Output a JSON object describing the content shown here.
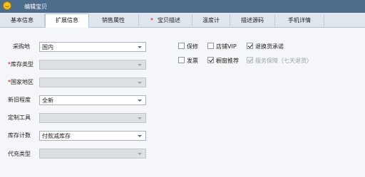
{
  "window": {
    "title": "编辑宝贝"
  },
  "tabs": [
    {
      "label": "基本信息",
      "required": false,
      "active": false
    },
    {
      "label": "扩展信息",
      "required": false,
      "active": true
    },
    {
      "label": "销售属性",
      "required": false,
      "active": false
    },
    {
      "label": "宝贝描述",
      "required": true,
      "active": false
    },
    {
      "label": "温度计",
      "required": false,
      "active": false
    },
    {
      "label": "描述源码",
      "required": false,
      "active": false
    },
    {
      "label": "手机详情",
      "required": false,
      "active": false
    }
  ],
  "form": {
    "origin": {
      "label": "采购地",
      "value": "国内",
      "required": false,
      "disabled": false
    },
    "stock_type": {
      "label": "库存类型",
      "value": "",
      "required": true,
      "disabled": true
    },
    "country": {
      "label": "国家地区",
      "value": "",
      "required": true,
      "disabled": true
    },
    "condition": {
      "label": "新旧程度",
      "value": "全新",
      "required": false,
      "disabled": false
    },
    "custom_tool": {
      "label": "定制工具",
      "value": "",
      "required": false,
      "disabled": true
    },
    "stock_count": {
      "label": "库存计数",
      "value": "付款减库存",
      "required": false,
      "disabled": false
    },
    "agent_type": {
      "label": "代充类型",
      "value": "",
      "required": false,
      "disabled": true
    }
  },
  "star_symbol": "*",
  "options": {
    "warranty": {
      "label": "保修",
      "checked": false,
      "disabled": false
    },
    "shop_vip": {
      "label": "店铺VIP",
      "checked": false,
      "disabled": false
    },
    "return_promise": {
      "label": "退换货承诺",
      "checked": true,
      "disabled": false
    },
    "invoice": {
      "label": "发票",
      "checked": false,
      "disabled": false
    },
    "showcase": {
      "label": "橱窗推荐",
      "checked": true,
      "disabled": false
    },
    "service_guarantee": {
      "label": "服务保障（七天退货）",
      "checked": true,
      "disabled": true
    }
  },
  "colors": {
    "titlebar": "#4d6c8b",
    "required_star": "#d00000",
    "tab_bar": "#dfe6ee",
    "panel": "#f4f6f9"
  }
}
